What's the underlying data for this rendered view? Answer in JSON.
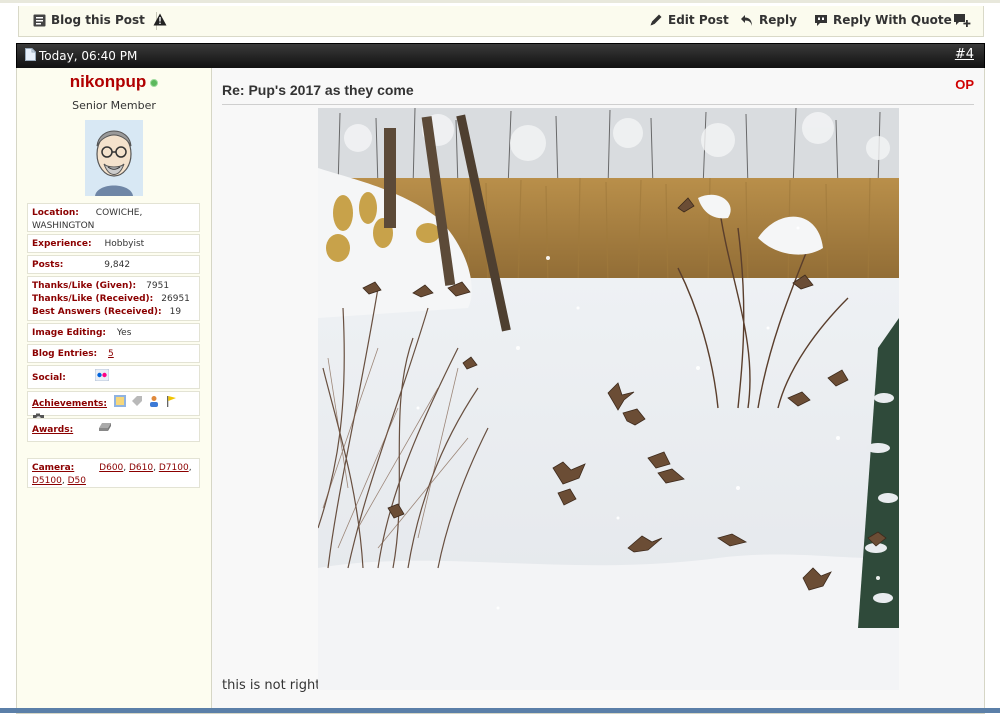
{
  "prev_post_bar": {
    "blog_label": "Blog this Post",
    "edit_label": "Edit Post",
    "reply_label": "Reply",
    "quote_label": "Reply With Quote"
  },
  "post": {
    "date": "Today, 06:40 PM",
    "number": "#4",
    "title": "Re: Pup's 2017 as they come",
    "op_badge": "OP",
    "text": "this is not right",
    "image_desc": "snow-birds-photo"
  },
  "user": {
    "name": "nikonpup",
    "title": "Senior Member",
    "location_label": "Location:",
    "location": "COWICHE, WASHINGTON",
    "experience_label": "Experience:",
    "experience": "Hobbyist",
    "posts_label": "Posts:",
    "posts": "9,842",
    "thanks_given_label": "Thanks/Like (Given):",
    "thanks_given": "7951",
    "thanks_received_label": "Thanks/Like (Received):",
    "thanks_received": "26951",
    "best_answers_label": "Best Answers (Received):",
    "best_answers": "19",
    "image_editing_label": "Image Editing:",
    "image_editing": "Yes",
    "blog_entries_label": "Blog Entries:",
    "blog_entries": "5",
    "social_label": "Social:",
    "achievements_label": "Achievements:",
    "awards_label": "Awards:",
    "camera_label": "Camera:",
    "cameras": [
      "D600",
      "D610",
      "D7100",
      "D5100",
      "D50"
    ]
  },
  "colors": {
    "accent_red": "#b00000",
    "header_dark": "#1a1a1a",
    "sidebar_bg": "#fdfdf0"
  }
}
